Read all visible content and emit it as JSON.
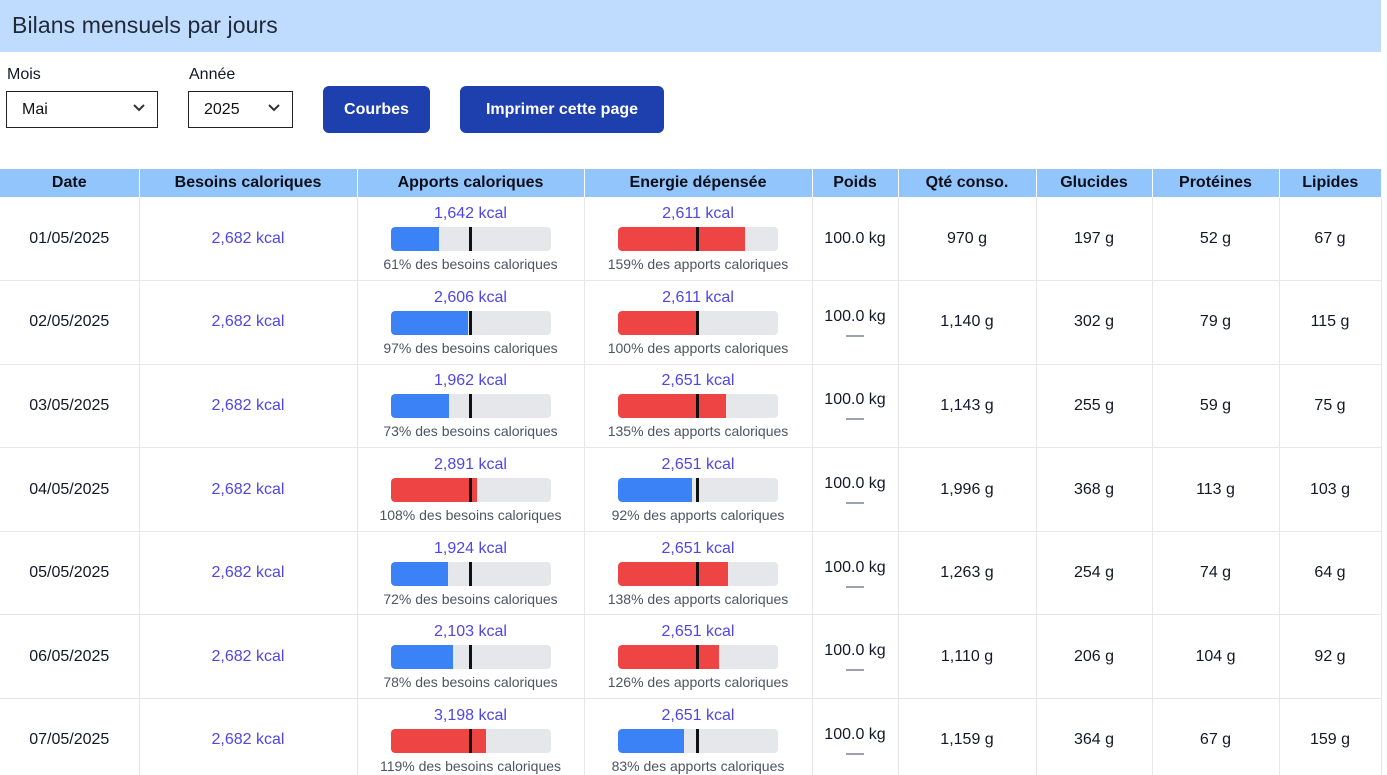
{
  "header": {
    "title": "Bilans mensuels par jours"
  },
  "controls": {
    "month_label": "Mois",
    "month_value": "Mai",
    "year_label": "Année",
    "year_value": "2025",
    "btn_curves": "Courbes",
    "btn_print": "Imprimer cette page"
  },
  "table": {
    "columns": [
      "Date",
      "Besoins caloriques",
      "Apports caloriques",
      "Energie dépensée",
      "Poids",
      "Qté conso.",
      "Glucides",
      "Protéines",
      "Lipides"
    ],
    "rows": [
      {
        "date": "01/05/2025",
        "besoins": "2,682 kcal",
        "apports": "1,642 kcal",
        "apports_pct": 61,
        "apports_color": "blue",
        "apports_note": "61% des besoins caloriques",
        "energie": "2,611 kcal",
        "energie_pct": 159,
        "energie_color": "red",
        "energie_note": "159% des apports caloriques",
        "poids": "100.0 kg",
        "poids_dash": false,
        "qte": "970 g",
        "glucides": "197 g",
        "proteines": "52 g",
        "lipides": "67 g"
      },
      {
        "date": "02/05/2025",
        "besoins": "2,682 kcal",
        "apports": "2,606 kcal",
        "apports_pct": 97,
        "apports_color": "blue",
        "apports_note": "97% des besoins caloriques",
        "energie": "2,611 kcal",
        "energie_pct": 100,
        "energie_color": "red",
        "energie_note": "100% des apports caloriques",
        "poids": "100.0 kg",
        "poids_dash": true,
        "qte": "1,140 g",
        "glucides": "302 g",
        "proteines": "79 g",
        "lipides": "115 g"
      },
      {
        "date": "03/05/2025",
        "besoins": "2,682 kcal",
        "apports": "1,962 kcal",
        "apports_pct": 73,
        "apports_color": "blue",
        "apports_note": "73% des besoins caloriques",
        "energie": "2,651 kcal",
        "energie_pct": 135,
        "energie_color": "red",
        "energie_note": "135% des apports caloriques",
        "poids": "100.0 kg",
        "poids_dash": true,
        "qte": "1,143 g",
        "glucides": "255 g",
        "proteines": "59 g",
        "lipides": "75 g"
      },
      {
        "date": "04/05/2025",
        "besoins": "2,682 kcal",
        "apports": "2,891 kcal",
        "apports_pct": 108,
        "apports_color": "red",
        "apports_note": "108% des besoins caloriques",
        "energie": "2,651 kcal",
        "energie_pct": 92,
        "energie_color": "blue",
        "energie_note": "92% des apports caloriques",
        "poids": "100.0 kg",
        "poids_dash": true,
        "qte": "1,996 g",
        "glucides": "368 g",
        "proteines": "113 g",
        "lipides": "103 g"
      },
      {
        "date": "05/05/2025",
        "besoins": "2,682 kcal",
        "apports": "1,924 kcal",
        "apports_pct": 72,
        "apports_color": "blue",
        "apports_note": "72% des besoins caloriques",
        "energie": "2,651 kcal",
        "energie_pct": 138,
        "energie_color": "red",
        "energie_note": "138% des apports caloriques",
        "poids": "100.0 kg",
        "poids_dash": true,
        "qte": "1,263 g",
        "glucides": "254 g",
        "proteines": "74 g",
        "lipides": "64 g"
      },
      {
        "date": "06/05/2025",
        "besoins": "2,682 kcal",
        "apports": "2,103 kcal",
        "apports_pct": 78,
        "apports_color": "blue",
        "apports_note": "78% des besoins caloriques",
        "energie": "2,651 kcal",
        "energie_pct": 126,
        "energie_color": "red",
        "energie_note": "126% des apports caloriques",
        "poids": "100.0 kg",
        "poids_dash": true,
        "qte": "1,110 g",
        "glucides": "206 g",
        "proteines": "104 g",
        "lipides": "92 g"
      },
      {
        "date": "07/05/2025",
        "besoins": "2,682 kcal",
        "apports": "3,198 kcal",
        "apports_pct": 119,
        "apports_color": "red",
        "apports_note": "119% des besoins caloriques",
        "energie": "2,651 kcal",
        "energie_pct": 83,
        "energie_color": "blue",
        "energie_note": "83% des apports caloriques",
        "poids": "100.0 kg",
        "poids_dash": true,
        "qte": "1,159 g",
        "glucides": "364 g",
        "proteines": "67 g",
        "lipides": "159 g"
      }
    ]
  },
  "colors": {
    "header_bg": "#bfdbfe",
    "table_header_bg": "#93c5fd",
    "button_bg": "#1e40af",
    "kcal_text": "#4f46e5",
    "bar_blue": "#3b82f6",
    "bar_red": "#ef4444",
    "bar_track": "#e5e7eb"
  }
}
